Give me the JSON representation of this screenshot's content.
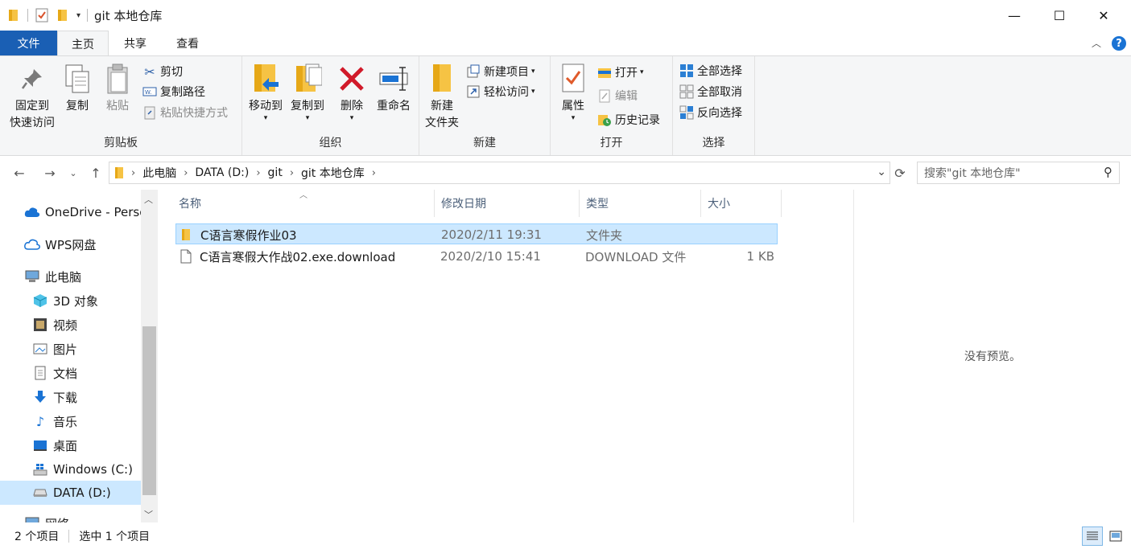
{
  "window": {
    "title": "git 本地仓库",
    "minimize_glyph": "—",
    "maximize_glyph": "☐",
    "close_glyph": "✕"
  },
  "tabs": [
    {
      "label": "文件"
    },
    {
      "label": "主页"
    },
    {
      "label": "共享"
    },
    {
      "label": "查看"
    }
  ],
  "ribbon": {
    "clipboard": {
      "title": "剪贴板",
      "pin_label_1": "固定到",
      "pin_label_2": "快速访问",
      "copy": "复制",
      "paste": "粘贴",
      "cut": "剪切",
      "copy_path": "复制路径",
      "paste_shortcut": "粘贴快捷方式"
    },
    "organize": {
      "title": "组织",
      "move_to": "移动到",
      "copy_to": "复制到",
      "delete": "删除",
      "rename": "重命名"
    },
    "new": {
      "title": "新建",
      "new_folder_1": "新建",
      "new_folder_2": "文件夹",
      "new_item": "新建项目",
      "easy_access": "轻松访问"
    },
    "open": {
      "title": "打开",
      "properties": "属性",
      "open": "打开",
      "edit": "编辑",
      "history": "历史记录"
    },
    "select": {
      "title": "选择",
      "select_all": "全部选择",
      "select_none": "全部取消",
      "invert": "反向选择"
    }
  },
  "address": {
    "crumbs": [
      "此电脑",
      "DATA (D:)",
      "git",
      "git 本地仓库"
    ],
    "search_placeholder": "搜索\"git 本地仓库\""
  },
  "nav": {
    "items": [
      {
        "label": "OneDrive - Perso"
      },
      {
        "label": "WPS网盘"
      },
      {
        "label": "此电脑"
      },
      {
        "label": "3D 对象"
      },
      {
        "label": "视频"
      },
      {
        "label": "图片"
      },
      {
        "label": "文档"
      },
      {
        "label": "下载"
      },
      {
        "label": "音乐"
      },
      {
        "label": "桌面"
      },
      {
        "label": "Windows (C:)"
      },
      {
        "label": "DATA (D:)"
      },
      {
        "label": "网络"
      }
    ]
  },
  "columns": {
    "name": "名称",
    "modified": "修改日期",
    "type": "类型",
    "size": "大小"
  },
  "files": [
    {
      "name": "C语言寒假作业03",
      "modified": "2020/2/11 19:31",
      "type": "文件夹",
      "size": ""
    },
    {
      "name": "C语言寒假大作战02.exe.download",
      "modified": "2020/2/10 15:41",
      "type": "DOWNLOAD 文件",
      "size": "1 KB"
    }
  ],
  "preview": {
    "text": "没有预览。"
  },
  "status": {
    "count": "2 个项目",
    "selected": "选中 1 个项目"
  },
  "colors": {
    "file_tab": "#1a5fb4",
    "selection": "#cce8ff",
    "folder": "#f6c344"
  }
}
